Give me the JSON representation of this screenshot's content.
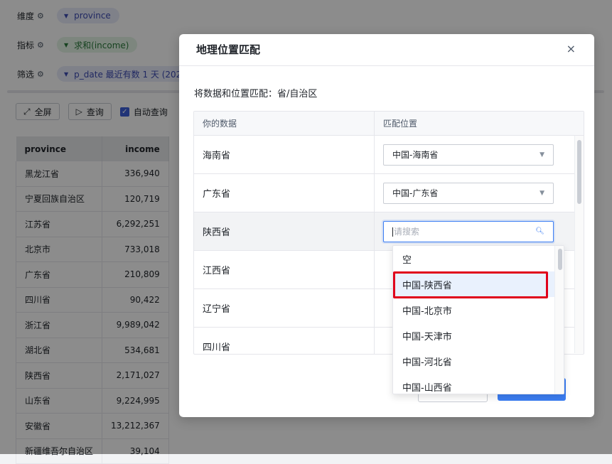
{
  "config": {
    "dimension": {
      "label": "维度",
      "pill": "province"
    },
    "metric": {
      "label": "指标",
      "pill": "求和(income)"
    },
    "filter": {
      "label": "筛选",
      "pill": "p_date  最近有数 1 天 (202"
    }
  },
  "toolbar": {
    "fullscreen": "全屏",
    "query": "查询",
    "auto_query": "自动查询"
  },
  "table": {
    "columns": [
      "province",
      "income"
    ],
    "rows": [
      [
        "黑龙江省",
        "336,940"
      ],
      [
        "宁夏回族自治区",
        "120,719"
      ],
      [
        "江苏省",
        "6,292,251"
      ],
      [
        "北京市",
        "733,018"
      ],
      [
        "广东省",
        "210,809"
      ],
      [
        "四川省",
        "90,422"
      ],
      [
        "浙江省",
        "9,989,042"
      ],
      [
        "湖北省",
        "534,681"
      ],
      [
        "陕西省",
        "2,171,027"
      ],
      [
        "山东省",
        "9,224,995"
      ],
      [
        "安徽省",
        "13,212,367"
      ],
      [
        "新疆维吾尔自治区",
        "39,104"
      ]
    ]
  },
  "modal": {
    "title": "地理位置匹配",
    "close": "×",
    "description": "将数据和位置匹配：省/自治区",
    "col_your_data": "你的数据",
    "col_match": "匹配位置",
    "rows": [
      {
        "data": "海南省",
        "match": "中国-海南省"
      },
      {
        "data": "广东省",
        "match": "中国-广东省"
      },
      {
        "data": "陕西省",
        "match": ""
      },
      {
        "data": "江西省",
        "match": ""
      },
      {
        "data": "辽宁省",
        "match": ""
      },
      {
        "data": "四川省",
        "match": ""
      }
    ],
    "search_placeholder": "请搜索"
  },
  "dropdown": {
    "options": [
      "空",
      "中国-陕西省",
      "中国-北京市",
      "中国-天津市",
      "中国-河北省",
      "中国-山西省"
    ],
    "selected_index": 1
  },
  "colors": {
    "accent": "#3c7ef3",
    "highlight_box": "#e0001b"
  }
}
